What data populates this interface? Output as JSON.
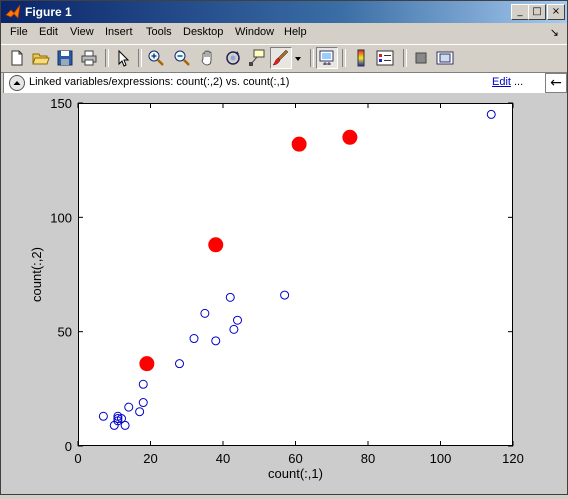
{
  "window": {
    "title": "Figure 1",
    "controls": [
      "_",
      "□",
      "×"
    ]
  },
  "menu": [
    "File",
    "Edit",
    "View",
    "Insert",
    "Tools",
    "Desktop",
    "Window",
    "Help"
  ],
  "menu_dock_glyph": "↘",
  "toolbar": {
    "buttons": [
      "new-figure",
      "open-file",
      "save",
      "print",
      "edit-plot",
      "zoom-in",
      "zoom-out",
      "pan",
      "rotate-3d",
      "data-cursor",
      "brush",
      "brush-menu",
      "link-plot",
      "insert-colorbar",
      "insert-legend",
      "hide-plot-tools",
      "show-plot-tools"
    ]
  },
  "linkbar": {
    "text": "Linked variables/expressions: count(:,2) vs. count(:,1)",
    "edit_label": "Edit",
    "ellipsis": "...",
    "arrow_glyph": "←"
  },
  "chart_data": {
    "type": "scatter",
    "xlabel": "count(:,1)",
    "ylabel": "count(:,2)",
    "xlim": [
      0,
      120
    ],
    "ylim": [
      0,
      150
    ],
    "xticks": [
      0,
      20,
      40,
      60,
      80,
      100,
      120
    ],
    "yticks": [
      0,
      50,
      100,
      150
    ],
    "grid": false,
    "colors": {
      "points": "#0000cc",
      "brushed": "#ff0000",
      "axes_bg": "#ffffff",
      "figure_bg": "#cccccc"
    },
    "points": [
      [
        7,
        13
      ],
      [
        10,
        9
      ],
      [
        11,
        11
      ],
      [
        11,
        13
      ],
      [
        11,
        12
      ],
      [
        12,
        12
      ],
      [
        13,
        9
      ],
      [
        14,
        17
      ],
      [
        17,
        15
      ],
      [
        18,
        19
      ],
      [
        18,
        27
      ],
      [
        28,
        36
      ],
      [
        32,
        47
      ],
      [
        35,
        58
      ],
      [
        38,
        46
      ],
      [
        42,
        65
      ],
      [
        43,
        51
      ],
      [
        44,
        55
      ],
      [
        57,
        66
      ],
      [
        114,
        145
      ]
    ],
    "brushed_points": [
      [
        19,
        36
      ],
      [
        38,
        88
      ],
      [
        61,
        132
      ],
      [
        75,
        135
      ]
    ]
  }
}
